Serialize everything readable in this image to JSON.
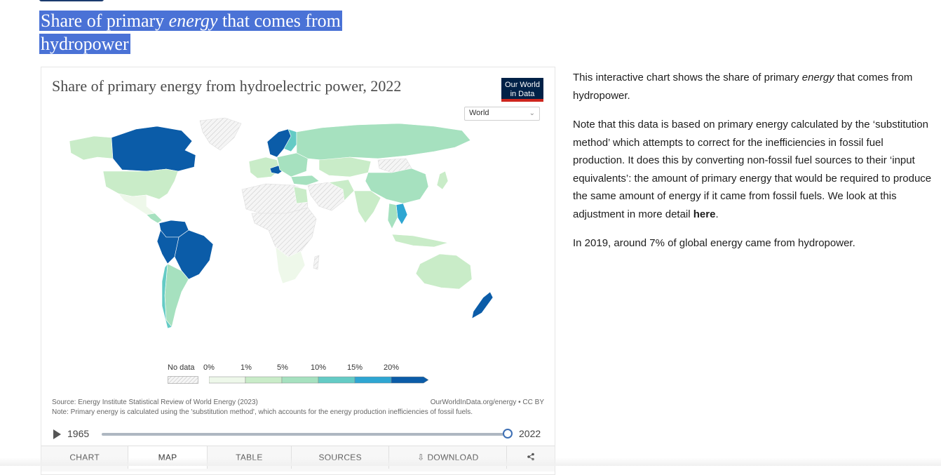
{
  "page": {
    "title_part1": "Share of primary ",
    "title_em": "energy",
    "title_part2": " that comes from hydropower"
  },
  "chart": {
    "title": "Share of primary energy from hydroelectric power, 2022",
    "logo_line1": "Our World",
    "logo_line2": "in Data",
    "region_selected": "World",
    "source": "Source: Energy Institute Statistical Review of World Energy (2023)",
    "note": "Note: Primary energy is calculated using the 'substitution method', which accounts for the energy production inefficiencies of fossil fuels.",
    "credit": "OurWorldInData.org/energy • CC BY",
    "timeline_start": "1965",
    "timeline_end": "2022",
    "timeline_position": 1.0,
    "colors": {
      "c0": "#eef8ea",
      "c1": "#c9ecc8",
      "c2": "#a6e1bf",
      "c3": "#64cbc5",
      "c4": "#2ea6d2",
      "c5": "#0b5ca8",
      "nodata": "#f2f2f2"
    }
  },
  "chart_data": {
    "type": "choropleth map",
    "title": "Share of primary energy from hydroelectric power, 2022",
    "legend": {
      "no_data_label": "No data",
      "bins": [
        "0%",
        "1%",
        "5%",
        "10%",
        "15%",
        "20%"
      ]
    }
  },
  "tabs": {
    "chart": "CHART",
    "map": "MAP",
    "table": "TABLE",
    "sources": "SOURCES",
    "download": "DOWNLOAD"
  },
  "side": {
    "p1_a": "This interactive chart shows the share of primary ",
    "p1_em": "energy",
    "p1_b": " that comes from hydropower.",
    "p2_a": "Note that this data is based on primary energy calculated by the ‘substitution method’ which attempts to correct for the inefficiencies in fossil fuel production. It does this by converting non-fossil fuel sources to their ‘input equivalents’: the amount of primary energy that would be required to produce the same amount of energy if it came from fossil fuels. We look at this adjustment in more detail ",
    "p2_link": "here",
    "p2_b": ".",
    "p3": "In 2019, around 7% of global energy came from hydropower."
  }
}
